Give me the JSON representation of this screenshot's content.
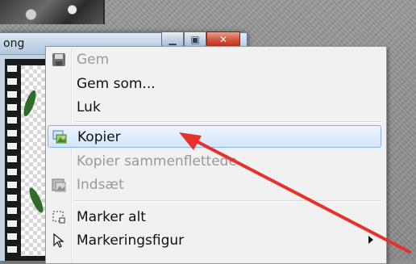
{
  "window": {
    "title_fragment": "ong"
  },
  "menu": {
    "items": [
      {
        "label": "Gem",
        "icon": "save-icon",
        "disabled": true
      },
      {
        "label": "Gem som...",
        "icon": "",
        "disabled": false
      },
      {
        "label": "Luk",
        "icon": "",
        "disabled": false
      },
      {
        "label": "Kopier",
        "icon": "copy-image-icon",
        "disabled": false,
        "highlighted": true
      },
      {
        "label": "Kopier sammenflettede",
        "icon": "",
        "disabled": true
      },
      {
        "label": "Indsæt",
        "icon": "paste-image-icon",
        "disabled": true
      },
      {
        "label": "Marker alt",
        "icon": "select-all-icon",
        "disabled": false
      },
      {
        "label": "Markeringsfigur",
        "icon": "cursor-arrow-icon",
        "disabled": false,
        "submenu": true
      }
    ]
  },
  "colors": {
    "annotation_arrow": "#e8312a",
    "highlight_border": "#87b3e4",
    "disabled_text": "#9a9a9a"
  }
}
